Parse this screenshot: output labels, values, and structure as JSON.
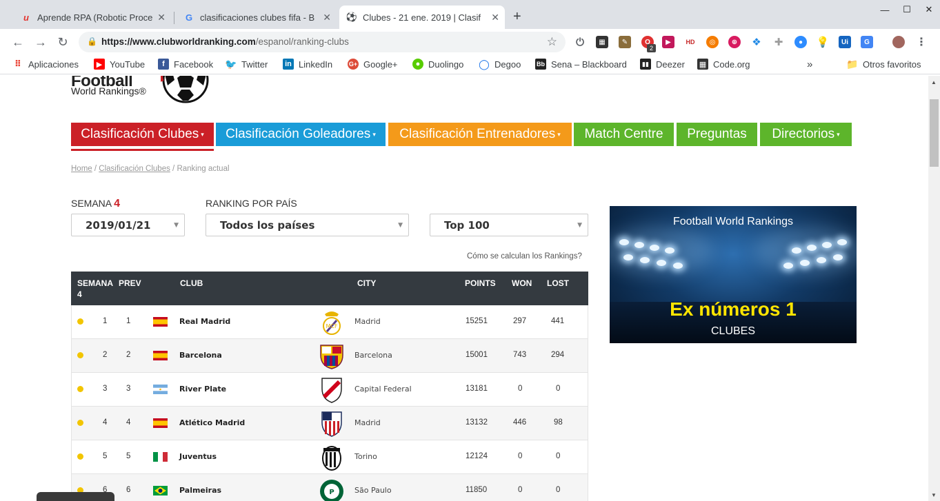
{
  "tabs": [
    {
      "title": "Aprende RPA (Robotic Proce",
      "favicon": "u"
    },
    {
      "title": "clasificaciones clubes fifa - B",
      "favicon": "G"
    },
    {
      "title": "Clubes - 21 ene. 2019 | Clasif",
      "favicon": "⚽"
    }
  ],
  "toolbar": {
    "url_domain": "https://www.clubworldranking.com",
    "url_path": "/espanol/ranking-clubs",
    "ext_badge": "2"
  },
  "bookmarks": {
    "items": [
      "Aplicaciones",
      "YouTube",
      "Facebook",
      "Twitter",
      "LinkedIn",
      "Google+",
      "Duolingo",
      "Degoo",
      "Sena – Blackboard",
      "Deezer",
      "Code.org"
    ],
    "more": "»",
    "other": "Otros favoritos"
  },
  "site": {
    "logo_title": "Football",
    "logo_sub": "World Rankings®"
  },
  "menu": [
    {
      "label": "Clasificación Clubes",
      "color": "#cb2027",
      "caret": "▾"
    },
    {
      "label": "Clasificación Goleadores",
      "color": "#1a9cd8",
      "caret": "▾"
    },
    {
      "label": "Clasificación Entrenadores",
      "color": "#f49a1a",
      "caret": "▾"
    },
    {
      "label": "Match Centre",
      "color": "#5db52b",
      "caret": ""
    },
    {
      "label": "Preguntas",
      "color": "#5db52b",
      "caret": ""
    },
    {
      "label": "Directorios",
      "color": "#5db52b",
      "caret": "▾"
    }
  ],
  "breadcrumb": {
    "home": "Home",
    "clubs": "Clasificación Clubes",
    "current": "Ranking actual",
    "sep": "/"
  },
  "filters": {
    "week_label": "SEMANA",
    "week_number": "4",
    "country_label": "RANKING POR PAÍS",
    "date_value": "2019/01/21",
    "country_value": "Todos los países",
    "top_value": "Top 100"
  },
  "how_link": "Cómo se calculan los Rankings?",
  "table": {
    "headers": {
      "week": "SEMANA",
      "week_n": "4",
      "prev": "PREV",
      "club": "CLUB",
      "city": "CITY",
      "points": "POINTS",
      "won": "WON",
      "lost": "LOST"
    },
    "rows": [
      {
        "rank": "1",
        "prev": "1",
        "club": "Real Madrid",
        "city": "Madrid",
        "points": "15251",
        "won": "297",
        "lost": "441",
        "flag": "es",
        "crest": "real-madrid"
      },
      {
        "rank": "2",
        "prev": "2",
        "club": "Barcelona",
        "city": "Barcelona",
        "points": "15001",
        "won": "743",
        "lost": "294",
        "flag": "es",
        "crest": "barcelona"
      },
      {
        "rank": "3",
        "prev": "3",
        "club": "River Plate",
        "city": "Capital Federal",
        "points": "13181",
        "won": "0",
        "lost": "0",
        "flag": "ar",
        "crest": "river-plate"
      },
      {
        "rank": "4",
        "prev": "4",
        "club": "Atlético Madrid",
        "city": "Madrid",
        "points": "13132",
        "won": "446",
        "lost": "98",
        "flag": "es",
        "crest": "atletico"
      },
      {
        "rank": "5",
        "prev": "5",
        "club": "Juventus",
        "city": "Torino",
        "points": "12124",
        "won": "0",
        "lost": "0",
        "flag": "it",
        "crest": "juventus"
      },
      {
        "rank": "6",
        "prev": "6",
        "club": "Palmeiras",
        "city": "São Paulo",
        "points": "11850",
        "won": "0",
        "lost": "0",
        "flag": "br",
        "crest": "palmeiras"
      }
    ]
  },
  "banner": {
    "title": "Football World Rankings",
    "headline": "Ex números 1",
    "sub": "CLUBES"
  }
}
